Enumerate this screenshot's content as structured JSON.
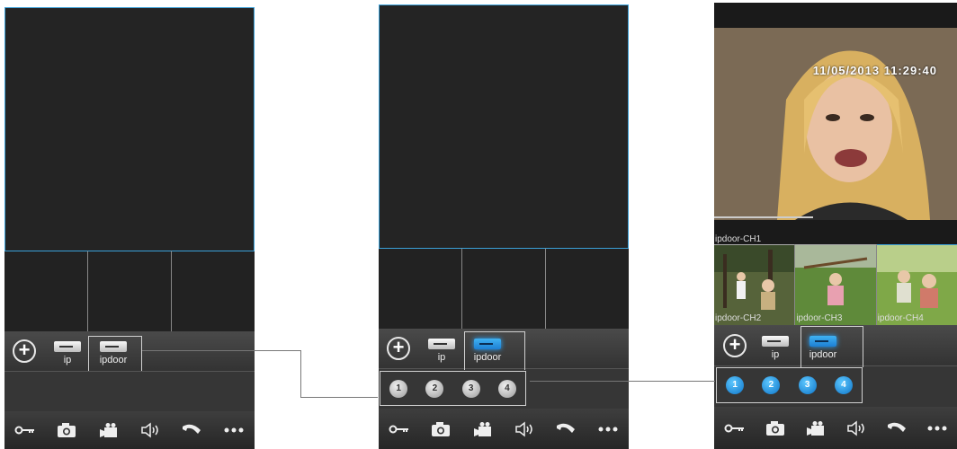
{
  "screens": [
    {
      "devices": [
        {
          "label": "ip",
          "active": false
        },
        {
          "label": "ipdoor",
          "active": false
        }
      ]
    },
    {
      "devices": [
        {
          "label": "ip",
          "active": false
        },
        {
          "label": "ipdoor",
          "active": true
        }
      ],
      "channels": [
        "1",
        "2",
        "3",
        "4"
      ]
    },
    {
      "timestamp": "11/05/2013 11:29:40",
      "main_channel_label": "ipdoor-CH1",
      "thumb_labels": [
        "ipdoor-CH2",
        "ipdoor-CH3",
        "ipdoor-CH4"
      ],
      "devices": [
        {
          "label": "ip",
          "active": false
        },
        {
          "label": "ipdoor",
          "active": true
        }
      ],
      "channels": [
        "1",
        "2",
        "3",
        "4"
      ]
    }
  ],
  "toolbar_icons": [
    "key-icon",
    "camera-icon",
    "video-camera-icon",
    "speaker-icon",
    "phone-handset-icon",
    "more-icon"
  ],
  "colors": {
    "accent": "#3aa0d8",
    "active_device": "#2aa6ff",
    "panel": "#1a1a1a"
  }
}
